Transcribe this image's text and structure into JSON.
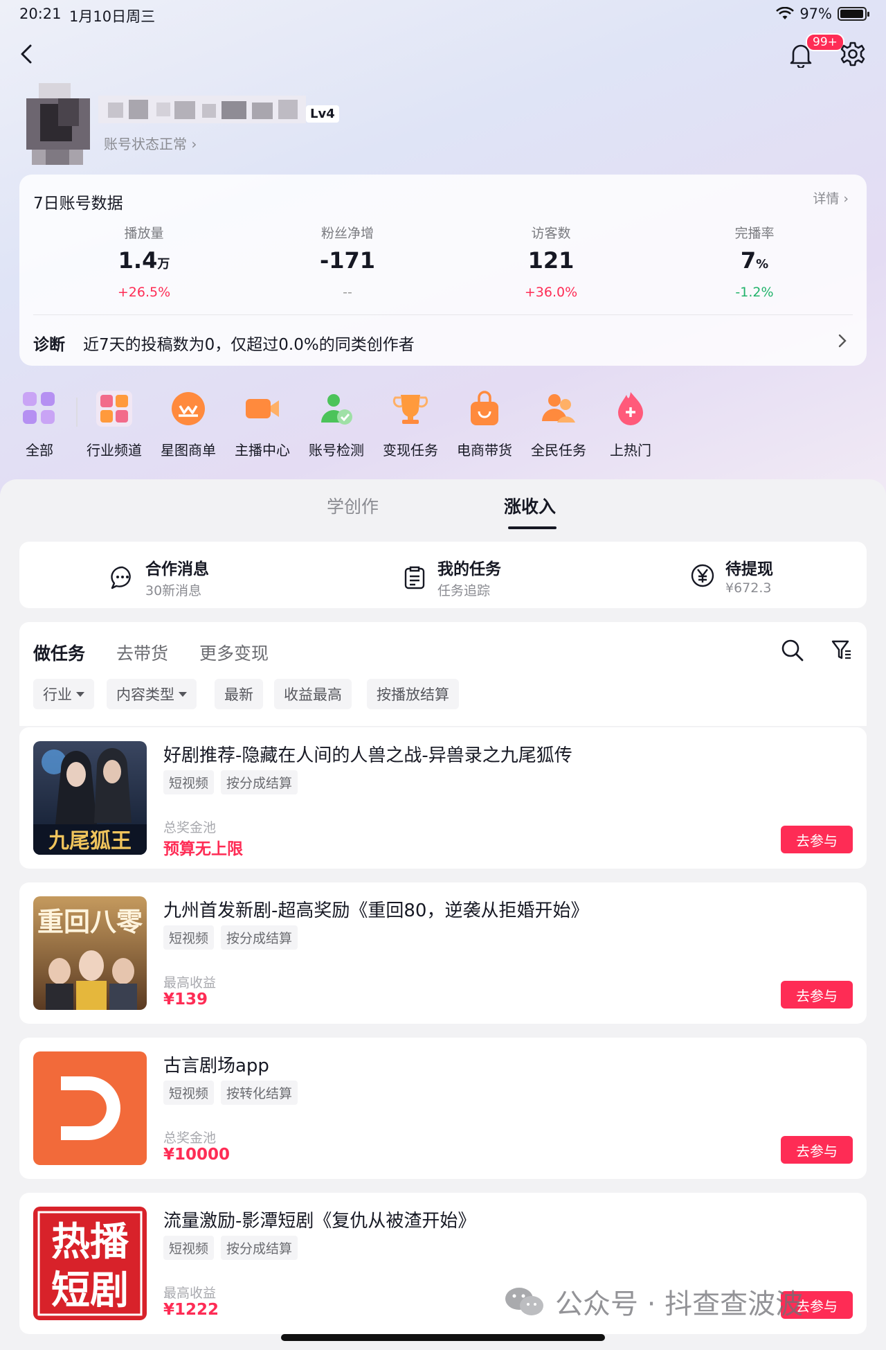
{
  "status_bar": {
    "time": "20:21",
    "date": "1月10日周三",
    "battery": "97%",
    "battery_level": 0.97
  },
  "header": {
    "notification_badge": "99+"
  },
  "profile": {
    "level": "Lv4",
    "account_status": "账号状态正常"
  },
  "stats": {
    "title": "7日账号数据",
    "detail_link": "详情",
    "metrics": [
      {
        "label": "播放量",
        "value": "1.4",
        "unit": "万",
        "change": "+26.5%"
      },
      {
        "label": "粉丝净增",
        "value": "-171",
        "unit": "",
        "change": "--"
      },
      {
        "label": "访客数",
        "value": "121",
        "unit": "",
        "change": "+36.0%"
      },
      {
        "label": "完播率",
        "value": "7",
        "unit": "%",
        "change": "-1.2%"
      }
    ],
    "diagnosis_label": "诊断",
    "diagnosis_text": "近7天的投稿数为0，仅超过0.0%的同类创作者"
  },
  "shortcuts": [
    {
      "label": "全部",
      "icon": "grid-icon"
    },
    {
      "label": "行业频道",
      "icon": "industry-icon"
    },
    {
      "label": "星图商单",
      "icon": "star-order-icon"
    },
    {
      "label": "主播中心",
      "icon": "camera-icon"
    },
    {
      "label": "账号检测",
      "icon": "account-check-icon"
    },
    {
      "label": "变现任务",
      "icon": "trophy-icon"
    },
    {
      "label": "电商带货",
      "icon": "shopping-bag-icon"
    },
    {
      "label": "全民任务",
      "icon": "people-icon"
    },
    {
      "label": "上热门",
      "icon": "flame-icon"
    }
  ],
  "main_tabs": [
    {
      "label": "学创作"
    },
    {
      "label": "涨收入"
    }
  ],
  "quick_actions": [
    {
      "title": "合作消息",
      "subtitle": "30新消息",
      "icon": "chat-icon"
    },
    {
      "title": "我的任务",
      "subtitle": "任务追踪",
      "icon": "clipboard-icon"
    },
    {
      "title": "待提现",
      "subtitle": "¥672.3",
      "icon": "yen-icon"
    }
  ],
  "sub_tabs": [
    {
      "label": "做任务"
    },
    {
      "label": "去带货"
    },
    {
      "label": "更多变现"
    }
  ],
  "filters": [
    {
      "label": "行业"
    },
    {
      "label": "内容类型"
    },
    {
      "label": "最新"
    },
    {
      "label": "收益最高"
    },
    {
      "label": "按播放结算"
    }
  ],
  "tasks": [
    {
      "title": "好剧推荐-隐藏在人间的人兽之战-异兽录之九尾狐传",
      "tags": [
        "短视频",
        "按分成结算"
      ],
      "price_label": "总奖金池",
      "price_value": "预算无上限",
      "button": "去参与",
      "thumb_text": "九尾狐王"
    },
    {
      "title": "九州首发新剧-超高奖励《重回80，逆袭从拒婚开始》",
      "tags": [
        "短视频",
        "按分成结算"
      ],
      "price_label": "最高收益",
      "price_value": "¥139",
      "button": "去参与",
      "thumb_text": "重回八零"
    },
    {
      "title": "古言剧场app",
      "tags": [
        "短视频",
        "按转化结算"
      ],
      "price_label": "总奖金池",
      "price_value": "¥10000",
      "button": "去参与",
      "thumb_text": ""
    },
    {
      "title": "流量激励-影潭短剧《复仇从被渣开始》",
      "tags": [
        "短视频",
        "按分成结算"
      ],
      "price_label": "最高收益",
      "price_value": "¥1222",
      "button": "去参与",
      "thumb_text": "热播短剧"
    }
  ],
  "watermark": {
    "text": "公众号 · 抖查查波波"
  },
  "colors": {
    "accent": "#fe2c55",
    "positive": "#fe2c55",
    "negative": "#22b36b",
    "text": "#161823",
    "muted": "#8a8b91"
  }
}
